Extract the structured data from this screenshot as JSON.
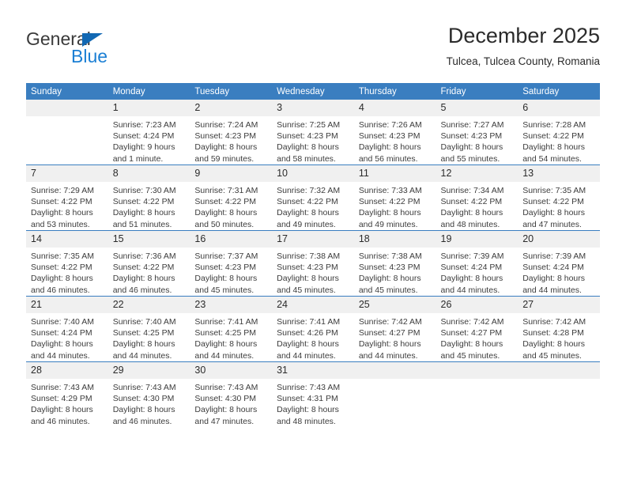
{
  "brand": {
    "name_top": "General",
    "name_bottom": "Blue",
    "triangle_color": "#1268b3",
    "blue_color": "#1b7fd4"
  },
  "header": {
    "title": "December 2025",
    "subtitle": "Tulcea, Tulcea County, Romania"
  },
  "theme": {
    "header_blue": "#3a7ec0",
    "daynum_bg": "#f0f0f0",
    "cell_bg": "#ffffff",
    "text": "#2b2b2b"
  },
  "weekdays": [
    "Sunday",
    "Monday",
    "Tuesday",
    "Wednesday",
    "Thursday",
    "Friday",
    "Saturday"
  ],
  "weeks": [
    [
      {
        "day": "",
        "blank": true,
        "sunrise": "",
        "sunset": "",
        "daylight1": "",
        "daylight2": ""
      },
      {
        "day": "1",
        "sunrise": "Sunrise: 7:23 AM",
        "sunset": "Sunset: 4:24 PM",
        "daylight1": "Daylight: 9 hours",
        "daylight2": "and 1 minute."
      },
      {
        "day": "2",
        "sunrise": "Sunrise: 7:24 AM",
        "sunset": "Sunset: 4:23 PM",
        "daylight1": "Daylight: 8 hours",
        "daylight2": "and 59 minutes."
      },
      {
        "day": "3",
        "sunrise": "Sunrise: 7:25 AM",
        "sunset": "Sunset: 4:23 PM",
        "daylight1": "Daylight: 8 hours",
        "daylight2": "and 58 minutes."
      },
      {
        "day": "4",
        "sunrise": "Sunrise: 7:26 AM",
        "sunset": "Sunset: 4:23 PM",
        "daylight1": "Daylight: 8 hours",
        "daylight2": "and 56 minutes."
      },
      {
        "day": "5",
        "sunrise": "Sunrise: 7:27 AM",
        "sunset": "Sunset: 4:23 PM",
        "daylight1": "Daylight: 8 hours",
        "daylight2": "and 55 minutes."
      },
      {
        "day": "6",
        "sunrise": "Sunrise: 7:28 AM",
        "sunset": "Sunset: 4:22 PM",
        "daylight1": "Daylight: 8 hours",
        "daylight2": "and 54 minutes."
      }
    ],
    [
      {
        "day": "7",
        "sunrise": "Sunrise: 7:29 AM",
        "sunset": "Sunset: 4:22 PM",
        "daylight1": "Daylight: 8 hours",
        "daylight2": "and 53 minutes."
      },
      {
        "day": "8",
        "sunrise": "Sunrise: 7:30 AM",
        "sunset": "Sunset: 4:22 PM",
        "daylight1": "Daylight: 8 hours",
        "daylight2": "and 51 minutes."
      },
      {
        "day": "9",
        "sunrise": "Sunrise: 7:31 AM",
        "sunset": "Sunset: 4:22 PM",
        "daylight1": "Daylight: 8 hours",
        "daylight2": "and 50 minutes."
      },
      {
        "day": "10",
        "sunrise": "Sunrise: 7:32 AM",
        "sunset": "Sunset: 4:22 PM",
        "daylight1": "Daylight: 8 hours",
        "daylight2": "and 49 minutes."
      },
      {
        "day": "11",
        "sunrise": "Sunrise: 7:33 AM",
        "sunset": "Sunset: 4:22 PM",
        "daylight1": "Daylight: 8 hours",
        "daylight2": "and 49 minutes."
      },
      {
        "day": "12",
        "sunrise": "Sunrise: 7:34 AM",
        "sunset": "Sunset: 4:22 PM",
        "daylight1": "Daylight: 8 hours",
        "daylight2": "and 48 minutes."
      },
      {
        "day": "13",
        "sunrise": "Sunrise: 7:35 AM",
        "sunset": "Sunset: 4:22 PM",
        "daylight1": "Daylight: 8 hours",
        "daylight2": "and 47 minutes."
      }
    ],
    [
      {
        "day": "14",
        "sunrise": "Sunrise: 7:35 AM",
        "sunset": "Sunset: 4:22 PM",
        "daylight1": "Daylight: 8 hours",
        "daylight2": "and 46 minutes."
      },
      {
        "day": "15",
        "sunrise": "Sunrise: 7:36 AM",
        "sunset": "Sunset: 4:22 PM",
        "daylight1": "Daylight: 8 hours",
        "daylight2": "and 46 minutes."
      },
      {
        "day": "16",
        "sunrise": "Sunrise: 7:37 AM",
        "sunset": "Sunset: 4:23 PM",
        "daylight1": "Daylight: 8 hours",
        "daylight2": "and 45 minutes."
      },
      {
        "day": "17",
        "sunrise": "Sunrise: 7:38 AM",
        "sunset": "Sunset: 4:23 PM",
        "daylight1": "Daylight: 8 hours",
        "daylight2": "and 45 minutes."
      },
      {
        "day": "18",
        "sunrise": "Sunrise: 7:38 AM",
        "sunset": "Sunset: 4:23 PM",
        "daylight1": "Daylight: 8 hours",
        "daylight2": "and 45 minutes."
      },
      {
        "day": "19",
        "sunrise": "Sunrise: 7:39 AM",
        "sunset": "Sunset: 4:24 PM",
        "daylight1": "Daylight: 8 hours",
        "daylight2": "and 44 minutes."
      },
      {
        "day": "20",
        "sunrise": "Sunrise: 7:39 AM",
        "sunset": "Sunset: 4:24 PM",
        "daylight1": "Daylight: 8 hours",
        "daylight2": "and 44 minutes."
      }
    ],
    [
      {
        "day": "21",
        "sunrise": "Sunrise: 7:40 AM",
        "sunset": "Sunset: 4:24 PM",
        "daylight1": "Daylight: 8 hours",
        "daylight2": "and 44 minutes."
      },
      {
        "day": "22",
        "sunrise": "Sunrise: 7:40 AM",
        "sunset": "Sunset: 4:25 PM",
        "daylight1": "Daylight: 8 hours",
        "daylight2": "and 44 minutes."
      },
      {
        "day": "23",
        "sunrise": "Sunrise: 7:41 AM",
        "sunset": "Sunset: 4:25 PM",
        "daylight1": "Daylight: 8 hours",
        "daylight2": "and 44 minutes."
      },
      {
        "day": "24",
        "sunrise": "Sunrise: 7:41 AM",
        "sunset": "Sunset: 4:26 PM",
        "daylight1": "Daylight: 8 hours",
        "daylight2": "and 44 minutes."
      },
      {
        "day": "25",
        "sunrise": "Sunrise: 7:42 AM",
        "sunset": "Sunset: 4:27 PM",
        "daylight1": "Daylight: 8 hours",
        "daylight2": "and 44 minutes."
      },
      {
        "day": "26",
        "sunrise": "Sunrise: 7:42 AM",
        "sunset": "Sunset: 4:27 PM",
        "daylight1": "Daylight: 8 hours",
        "daylight2": "and 45 minutes."
      },
      {
        "day": "27",
        "sunrise": "Sunrise: 7:42 AM",
        "sunset": "Sunset: 4:28 PM",
        "daylight1": "Daylight: 8 hours",
        "daylight2": "and 45 minutes."
      }
    ],
    [
      {
        "day": "28",
        "sunrise": "Sunrise: 7:43 AM",
        "sunset": "Sunset: 4:29 PM",
        "daylight1": "Daylight: 8 hours",
        "daylight2": "and 46 minutes."
      },
      {
        "day": "29",
        "sunrise": "Sunrise: 7:43 AM",
        "sunset": "Sunset: 4:30 PM",
        "daylight1": "Daylight: 8 hours",
        "daylight2": "and 46 minutes."
      },
      {
        "day": "30",
        "sunrise": "Sunrise: 7:43 AM",
        "sunset": "Sunset: 4:30 PM",
        "daylight1": "Daylight: 8 hours",
        "daylight2": "and 47 minutes."
      },
      {
        "day": "31",
        "sunrise": "Sunrise: 7:43 AM",
        "sunset": "Sunset: 4:31 PM",
        "daylight1": "Daylight: 8 hours",
        "daylight2": "and 48 minutes."
      },
      {
        "day": "",
        "blank": true,
        "sunrise": "",
        "sunset": "",
        "daylight1": "",
        "daylight2": ""
      },
      {
        "day": "",
        "blank": true,
        "sunrise": "",
        "sunset": "",
        "daylight1": "",
        "daylight2": ""
      },
      {
        "day": "",
        "blank": true,
        "sunrise": "",
        "sunset": "",
        "daylight1": "",
        "daylight2": ""
      }
    ]
  ]
}
